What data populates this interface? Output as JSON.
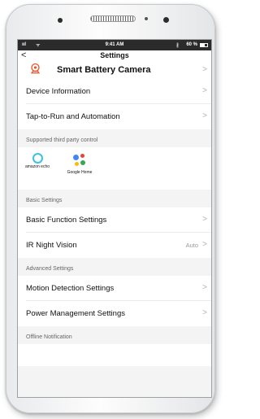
{
  "status_bar": {
    "signal": "ııl",
    "wifi": "ᯤ",
    "time": "9:41 AM",
    "bluetooth": "∦",
    "battery": "60 %"
  },
  "header": {
    "back_icon": "chevron-left",
    "title": "Settings"
  },
  "device": {
    "name": "Smart Battery Camera",
    "icon": "camera-icon",
    "icon_color": "#e8562e"
  },
  "rows_top": [
    {
      "label": "Device Information"
    },
    {
      "label": "Tap-to-Run and Automation"
    }
  ],
  "third_party": {
    "section_label": "Supported third party control",
    "items": [
      {
        "name": "amazon-echo",
        "label": "amazon echo"
      },
      {
        "name": "google-home",
        "label": "Google Home"
      }
    ]
  },
  "basic": {
    "section_label": "Basic Settings",
    "rows": [
      {
        "label": "Basic Function Settings",
        "value": ""
      },
      {
        "label": "IR Night Vision",
        "value": "Auto"
      }
    ]
  },
  "advanced": {
    "section_label": "Advanced Settings",
    "rows": [
      {
        "label": "Motion Detection Settings"
      },
      {
        "label": "Power Management Settings"
      }
    ]
  },
  "offline": {
    "section_label": "Offline Notification"
  },
  "chevron_glyph": ">",
  "colors": {
    "echo": "#3ec1e4",
    "google_blue": "#4285f4",
    "google_red": "#ea4335",
    "google_yellow": "#fbbc05",
    "google_green": "#34a853"
  }
}
